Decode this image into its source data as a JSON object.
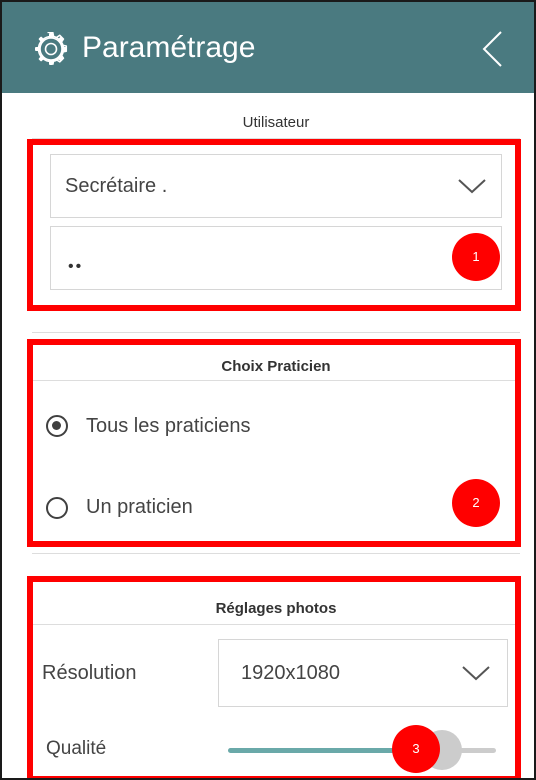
{
  "header": {
    "title": "Paramétrage",
    "left_icon": "gear-icon",
    "right_icon": "chevron-left-icon",
    "color": "#4a7a80"
  },
  "user_section": {
    "title": "Utilisateur",
    "user_select_value": "Secrétaire .",
    "password_value": "••"
  },
  "practitioner_section": {
    "title": "Choix Praticien",
    "options": [
      {
        "label": "Tous les praticiens",
        "selected": true
      },
      {
        "label": "Un praticien",
        "selected": false
      }
    ]
  },
  "photo_section": {
    "title": "Réglages photos",
    "resolution_label": "Résolution",
    "resolution_value": "1920x1080",
    "quality_label": "Qualité",
    "quality_percent": 85,
    "slider_color": "#6aa9a9"
  },
  "annotations": [
    {
      "number": "1"
    },
    {
      "number": "2"
    },
    {
      "number": "3"
    }
  ],
  "annotation_color": "#ff0000"
}
